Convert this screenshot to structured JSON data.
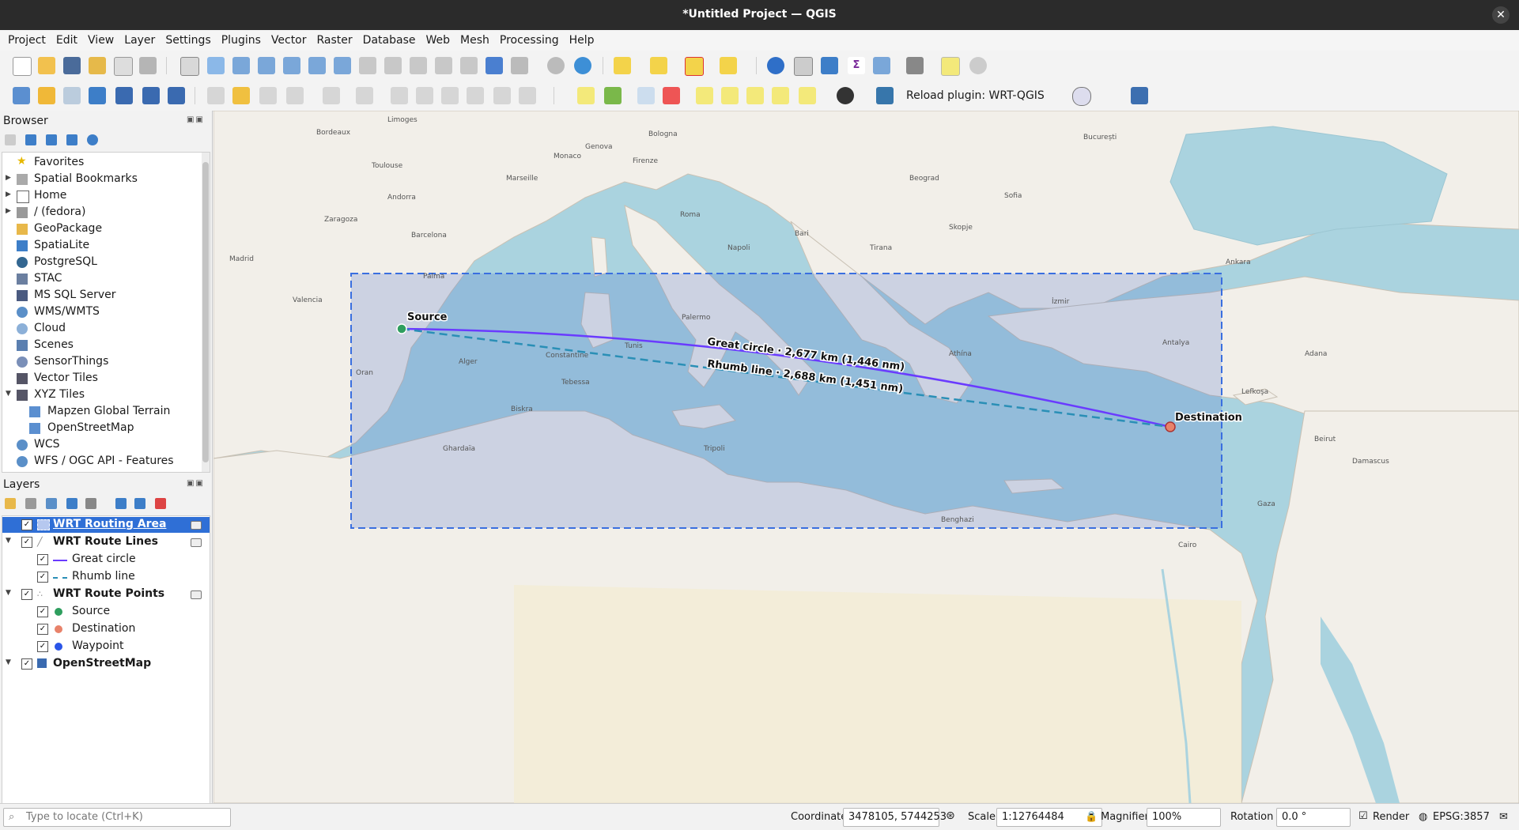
{
  "window": {
    "title": "*Untitled Project — QGIS"
  },
  "menu": [
    "Project",
    "Edit",
    "View",
    "Layer",
    "Settings",
    "Plugins",
    "Vector",
    "Raster",
    "Database",
    "Web",
    "Mesh",
    "Processing",
    "Help"
  ],
  "toolbar": {
    "reload_plugin_label": "Reload plugin: WRT-QGIS"
  },
  "browser": {
    "title": "Browser",
    "items": [
      {
        "label": "Favorites",
        "icon": "star-icon"
      },
      {
        "label": "Spatial Bookmarks",
        "icon": "bookmark-icon"
      },
      {
        "label": "Home",
        "icon": "home-folder-icon"
      },
      {
        "label": "/ (fedora)",
        "icon": "drive-icon"
      },
      {
        "label": "GeoPackage",
        "icon": "geopackage-icon"
      },
      {
        "label": "SpatiaLite",
        "icon": "spatialite-icon"
      },
      {
        "label": "PostgreSQL",
        "icon": "postgresql-icon"
      },
      {
        "label": "STAC",
        "icon": "stac-icon"
      },
      {
        "label": "MS SQL Server",
        "icon": "mssql-icon"
      },
      {
        "label": "WMS/WMTS",
        "icon": "globe-icon"
      },
      {
        "label": "Cloud",
        "icon": "cloud-icon"
      },
      {
        "label": "Scenes",
        "icon": "scenes-icon"
      },
      {
        "label": "SensorThings",
        "icon": "sensor-icon"
      },
      {
        "label": "Vector Tiles",
        "icon": "grid-icon"
      },
      {
        "label": "XYZ Tiles",
        "icon": "grid-icon"
      },
      {
        "label": "Mapzen Global Terrain",
        "icon": "grid-icon"
      },
      {
        "label": "OpenStreetMap",
        "icon": "grid-icon"
      },
      {
        "label": "WCS",
        "icon": "globe-icon"
      },
      {
        "label": "WFS / OGC API - Features",
        "icon": "globe-icon"
      }
    ]
  },
  "layers": {
    "title": "Layers",
    "items": [
      {
        "label": "WRT Routing Area"
      },
      {
        "label": "WRT Route Lines"
      },
      {
        "label": "Great circle"
      },
      {
        "label": "Rhumb line"
      },
      {
        "label": "WRT Route Points"
      },
      {
        "label": "Source"
      },
      {
        "label": "Destination"
      },
      {
        "label": "Waypoint"
      },
      {
        "label": "OpenStreetMap"
      }
    ]
  },
  "map": {
    "source_label": "Source",
    "destination_label": "Destination",
    "great_circle_label": "Great circle · 2,677 km (1,446 nm)",
    "rhumb_line_label": "Rhumb line · 2,688 km (1,451 nm)",
    "colors": {
      "great_circle": "#6a3bff",
      "rhumb_line": "#2a8fb6",
      "area_outline": "#3a6fe0",
      "source": "#2e9e5e",
      "destination": "#e8826a",
      "waypoint": "#2a55e8"
    },
    "place_labels": [
      "Limoges",
      "Bordeaux",
      "Toulouse",
      "Andorra",
      "Barcelona",
      "Zaragoza",
      "Madrid",
      "Valencia",
      "Palma",
      "Marseille",
      "Monaco",
      "Genova",
      "Bologna",
      "Firenze",
      "Roma",
      "Napoli",
      "Bari",
      "Palermo",
      "Tunis",
      "Alger",
      "Oran",
      "Constantine",
      "Biskra",
      "Tripoli",
      "Athína",
      "Sofia",
      "București",
      "Beograd",
      "Skopje",
      "Tirana",
      "İzmir",
      "Ankara",
      "Antalya",
      "Adana",
      "Lefkoşa",
      "Beirut",
      "Damascus",
      "Gaza",
      "Cairo",
      "Benghazi",
      "Tebessa",
      "Ghardaïa"
    ]
  },
  "statusbar": {
    "locate_placeholder": "Type to locate (Ctrl+K)",
    "coordinate_label": "Coordinate",
    "coordinate_value": "3478105, 5744253",
    "scale_label": "Scale",
    "scale_value": "1:12764484",
    "magnifier_label": "Magnifier",
    "magnifier_value": "100%",
    "rotation_label": "Rotation",
    "rotation_value": "0.0 °",
    "render_label": "Render",
    "crs_label": "EPSG:3857"
  }
}
